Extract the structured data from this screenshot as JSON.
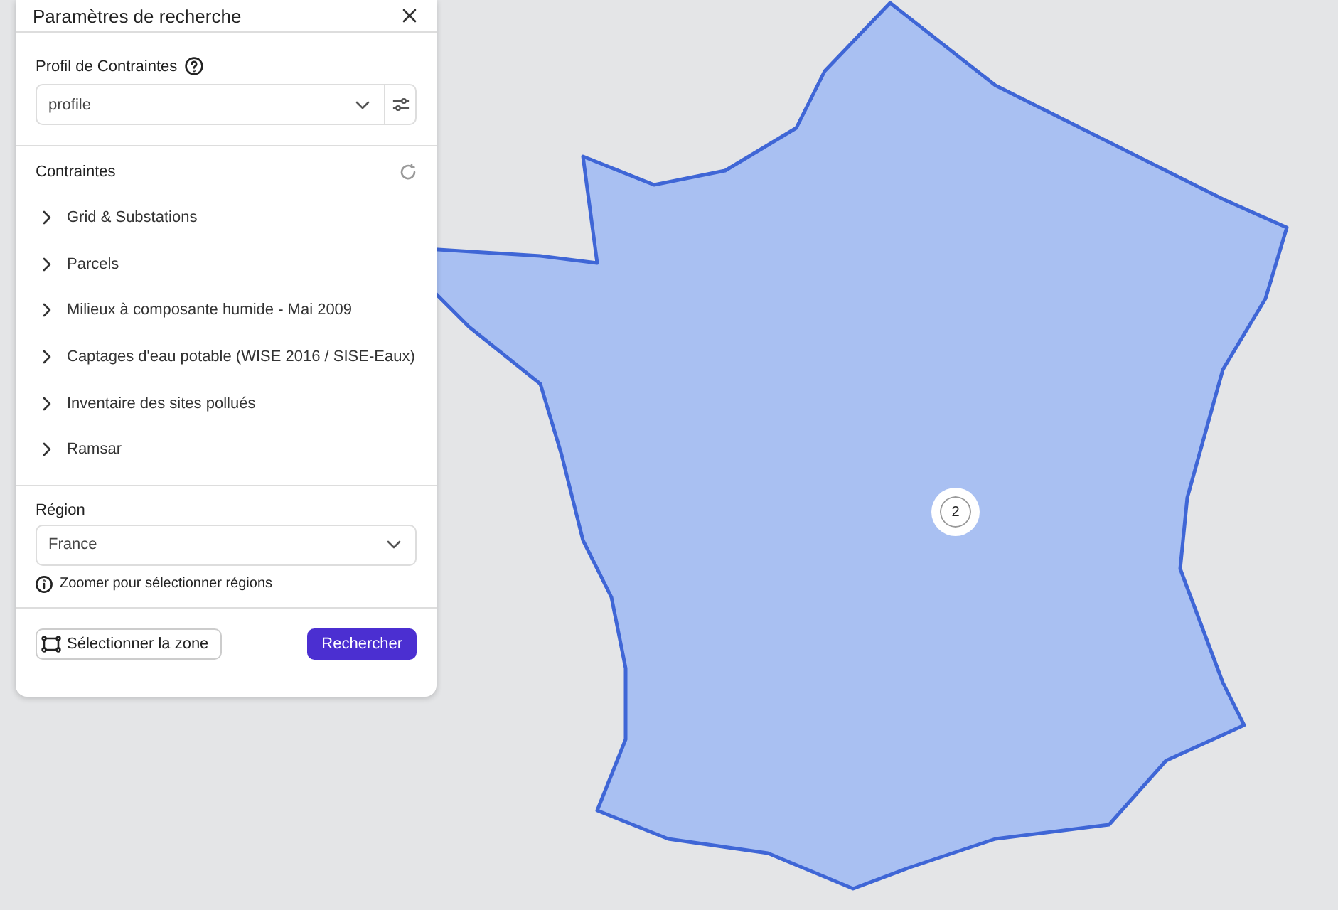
{
  "panel": {
    "title": "Paramètres de recherche",
    "profile": {
      "label": "Profil de Contraintes",
      "value": "profile"
    },
    "constraints": {
      "title": "Contraintes",
      "items": [
        {
          "label": "Grid & Substations",
          "expanded": false
        },
        {
          "label": "Parcels",
          "expanded": false
        },
        {
          "label": "Milieux à composante humide - Mai 2009",
          "expanded": false
        },
        {
          "label": "Captages d'eau potable (WISE 2016 / SISE-Eaux)",
          "expanded": false
        },
        {
          "label": "Inventaire des sites pollués",
          "expanded": false
        },
        {
          "label": "Ramsar",
          "expanded": false
        }
      ]
    },
    "region": {
      "label": "Région",
      "value": "France",
      "hint": "Zoomer pour sélectionner régions"
    },
    "buttons": {
      "select_zone": "Sélectionner la zone",
      "search": "Rechercher"
    }
  },
  "map": {
    "cluster": {
      "count": "2"
    }
  }
}
